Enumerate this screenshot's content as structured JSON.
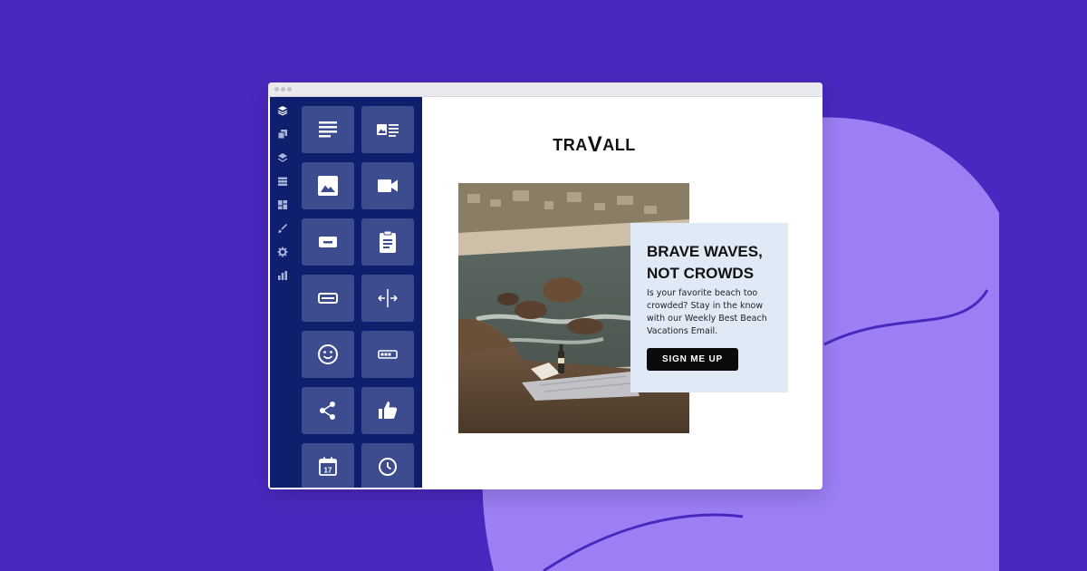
{
  "colors": {
    "background": "#4a28bf",
    "blob": "#9d7ef5",
    "sidebar": "#0f1f6e",
    "tile": "#3d4c8f",
    "promo_card": "#e0eaf6",
    "button": "#0a0a0a"
  },
  "editor": {
    "rail_icons": [
      "layers-icon",
      "copy-icon",
      "stack-icon",
      "rows-icon",
      "dashboard-icon",
      "brush-icon",
      "gear-icon",
      "bar-chart-icon"
    ],
    "blocks": [
      "text-block-icon",
      "image-text-block-icon",
      "image-block-icon",
      "video-block-icon",
      "button-block-icon",
      "form-block-icon",
      "input-field-block-icon",
      "spacer-block-icon",
      "emoji-block-icon",
      "progress-bar-block-icon",
      "share-block-icon",
      "thumbs-up-block-icon",
      "calendar-block-icon",
      "clock-block-icon"
    ],
    "calendar_day": "17"
  },
  "email": {
    "logo": {
      "part1": "TRA",
      "big": "V",
      "part2": "ALL"
    },
    "headline_line1": "BRAVE WAVES,",
    "headline_line2": "NOT CROWDS",
    "body": "Is your favorite beach too crowded? Stay in the know with our Weekly Best Beach Vacations Email.",
    "cta_label": "SIGN ME UP"
  }
}
